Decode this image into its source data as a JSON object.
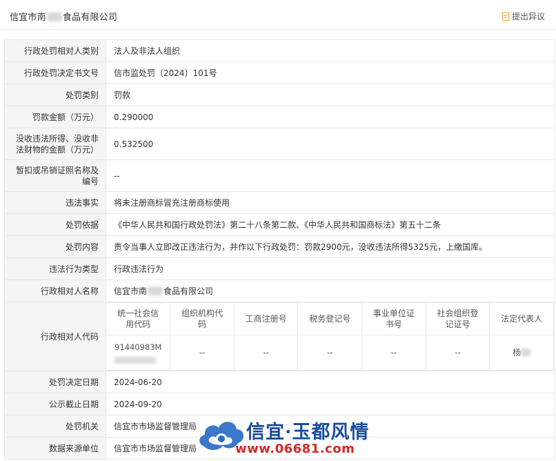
{
  "header": {
    "company_prefix": "信宜市南",
    "company_suffix": "食品有限公司",
    "objection_label": "提出异议"
  },
  "rows": [
    {
      "label": "行政处罚相对人类别",
      "value": "法人及非法人组织"
    },
    {
      "label": "行政处罚决定书文号",
      "value": "信市监处罚〔2024〕101号"
    },
    {
      "label": "处罚类别",
      "value": "罚款"
    },
    {
      "label": "罚款金额（万元）",
      "value": "0.290000"
    },
    {
      "label": "没收违法所得、没收非法财物的金额（万元）",
      "value": "0.532500"
    },
    {
      "label": "暂扣或吊销证照名称及编号",
      "value": "--"
    },
    {
      "label": "违法事实",
      "value": "将未注册商标冒充注册商标使用"
    },
    {
      "label": "处罚依据",
      "value": "《中华人民共和国行政处罚法》第二十八条第二款、《中华人民共和国商标法》第五十二条"
    },
    {
      "label": "处罚内容",
      "value": "责令当事人立即改正违法行为，并作以下行政处罚：罚款2900元，没收违法所得5325元，上缴国库。"
    },
    {
      "label": "违法行为类型",
      "value": "行政违法行为"
    },
    {
      "label": "行政相对人名称",
      "value_prefix": "信宜市南",
      "value_suffix": "食品有限公司"
    }
  ],
  "code_row": {
    "label": "行政相对人代码",
    "headers": [
      "统一社会信用代码",
      "组织机构代码",
      "工商注册号",
      "税务登记号",
      "事业单位证书号",
      "社会组织登记证号",
      "法定代表人"
    ],
    "values": [
      "91440983M",
      "--",
      "--",
      "--",
      "--",
      "--",
      "杨"
    ]
  },
  "rows_after": [
    {
      "label": "处罚决定日期",
      "value": "2024-06-20"
    },
    {
      "label": "公示截止日期",
      "value": "2024-09-20"
    },
    {
      "label": "处罚机关",
      "value": "信宜市市场监督管理局"
    },
    {
      "label": "数据来源单位",
      "value": "信宜市市场监督管理局"
    }
  ],
  "watermark": {
    "title": "信宜·玉都风情",
    "url": "www.06681.com"
  },
  "colors": {
    "label_bg": "#f5f5f5",
    "border": "#e8e8e8",
    "accent": "#f5a623",
    "watermark_blue": "#1a4d9e",
    "watermark_red": "#d62727"
  }
}
